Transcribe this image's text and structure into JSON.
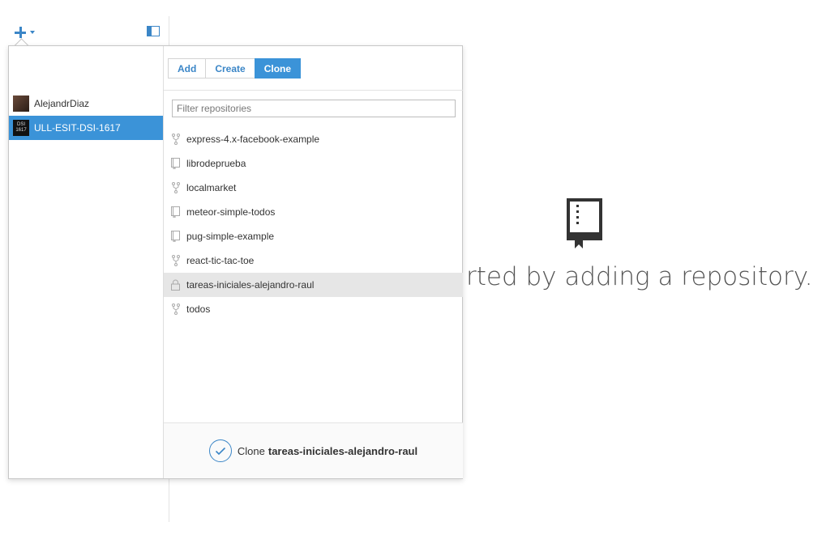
{
  "toolbar": {
    "add_icon": "plus-icon",
    "toggle_icon": "sidebar-toggle-icon"
  },
  "empty_state": {
    "icon": "repo-book-icon",
    "text": "rted by adding a repository."
  },
  "popover": {
    "tabs": [
      {
        "label": "Add",
        "active": false
      },
      {
        "label": "Create",
        "active": false
      },
      {
        "label": "Clone",
        "active": true
      }
    ],
    "accounts": [
      {
        "name": "AlejandrDiaz",
        "selected": false
      },
      {
        "name": "ULL-ESIT-DSI-1617",
        "selected": true,
        "avatar_text": "DSI 1617"
      }
    ],
    "filter": {
      "placeholder": "Filter repositories",
      "value": ""
    },
    "repos": [
      {
        "name": "express-4.x-facebook-example",
        "icon": "fork-icon"
      },
      {
        "name": "librodeprueba",
        "icon": "repo-icon"
      },
      {
        "name": "localmarket",
        "icon": "fork-icon"
      },
      {
        "name": "meteor-simple-todos",
        "icon": "repo-icon"
      },
      {
        "name": "pug-simple-example",
        "icon": "repo-icon"
      },
      {
        "name": "react-tic-tac-toe",
        "icon": "fork-icon"
      },
      {
        "name": "tareas-iniciales-alejandro-raul",
        "icon": "lock-icon",
        "highlighted": true
      },
      {
        "name": "todos",
        "icon": "fork-icon"
      }
    ],
    "clone_button": {
      "prefix": "Clone",
      "repo": "tareas-iniciales-alejandro-raul"
    }
  },
  "colors": {
    "accent": "#3b93d8",
    "icon_blue": "#3b86c7"
  }
}
